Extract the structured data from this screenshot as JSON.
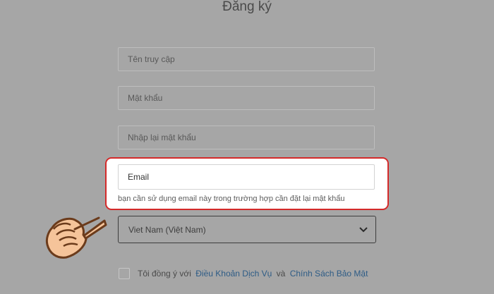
{
  "form": {
    "title": "Đăng ký",
    "username_placeholder": "Tên truy cập",
    "password_placeholder": "Mật khẩu",
    "confirm_password_placeholder": "Nhập lại mật khẩu",
    "email_placeholder": "Email",
    "email_hint": "bạn cần sử dụng email này trong trường hợp cần đặt lại mật khẩu",
    "country_selected": "Viet Nam (Việt Nam)",
    "agree_prefix": "Tôi đồng ý với",
    "terms_link": "Điều Khoản Dịch Vụ",
    "agree_and": "và",
    "privacy_link": "Chính Sách Bảo Mật"
  },
  "colors": {
    "overlay_background": "#a6a6a6",
    "highlight_border": "#d42a2a",
    "link": "#2e5c86"
  },
  "icons": {
    "pointer": "pointing-hand-icon",
    "dropdown": "chevron-down-icon"
  }
}
